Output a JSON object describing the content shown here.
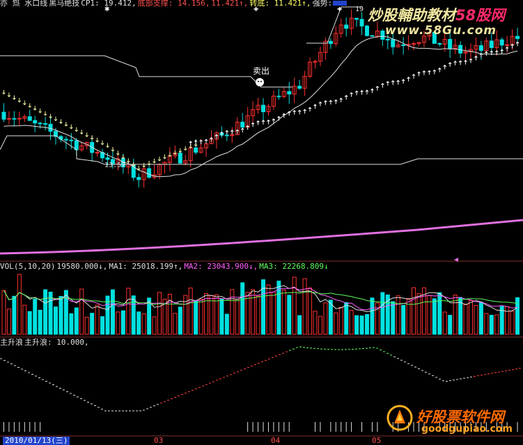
{
  "header_main": {
    "items": [
      {
        "text": "亦 炰 水口线",
        "color": "#e0e0e0"
      },
      {
        "text": "黑马绝技",
        "color": "#e0e0e0"
      },
      {
        "text": "CP1: 19.412,",
        "color": "#e0e0e0"
      },
      {
        "text": "底部支撑: 14.156,",
        "color": "#ff5050"
      },
      {
        "text": "11.421↑,",
        "color": "#ff5050"
      },
      {
        "text": "转底: 11.421↑,",
        "color": "#ffff60"
      },
      {
        "text": "强势:",
        "color": "#e0e0e0"
      }
    ]
  },
  "header_vol": {
    "items": [
      {
        "text": "VOL(5,10,20)",
        "color": "#e0e0e0"
      },
      {
        "text": "19580.000↓,",
        "color": "#e0e0e0"
      },
      {
        "text": "MA1: 25018.199↑,",
        "color": "#e0e0e0"
      },
      {
        "text": "MA2: 23043.900↓,",
        "color": "#ff60ff"
      },
      {
        "text": "MA3: 22268.809↓",
        "color": "#60ff60"
      }
    ]
  },
  "header_ind": {
    "items": [
      {
        "text": "主升浪",
        "color": "#e0e0e0"
      },
      {
        "text": "主升浪: 10.000,",
        "color": "#e0e0e0"
      }
    ]
  },
  "annotations": {
    "sell_label": "卖出",
    "low_label": "13.57",
    "high_label": "19"
  },
  "watermark_top": {
    "text": "炒股輔助教材",
    "brand": "58股网",
    "url": "www.58Gu.com"
  },
  "watermark_bottom": {
    "text": "好股票软件网",
    "url": "goodgupiao.com"
  },
  "date_bar": {
    "current_date": "2010/01/13(三)",
    "months": [
      "03",
      "04",
      "05"
    ]
  },
  "colors": {
    "background": "#000000",
    "up_candle": "#ff3030",
    "down_candle": "#00e0e0",
    "ma_line": "#e0e0e0",
    "support_line": "#e0e0e0",
    "trend_line": "#e070e0",
    "ma1": "#e0e0e0",
    "ma2": "#ff60ff",
    "ma3": "#60ff60"
  },
  "chart_data": [
    {
      "type": "candlestick",
      "title": "",
      "series": [
        {
          "name": "price"
        }
      ],
      "ylim": [
        13,
        20
      ],
      "notes": "Price panel: candlesticks with moving average, support line and buy/sell arrow markers"
    },
    {
      "type": "bar",
      "title": "VOL(5,10,20)",
      "series": [
        {
          "name": "VOL",
          "current": 19580.0
        },
        {
          "name": "MA1",
          "current": 25018.199
        },
        {
          "name": "MA2",
          "current": 23043.9
        },
        {
          "name": "MA3",
          "current": 22268.809
        }
      ]
    },
    {
      "type": "line",
      "title": "主升浪",
      "series": [
        {
          "name": "主升浪",
          "current": 10.0
        }
      ]
    }
  ]
}
